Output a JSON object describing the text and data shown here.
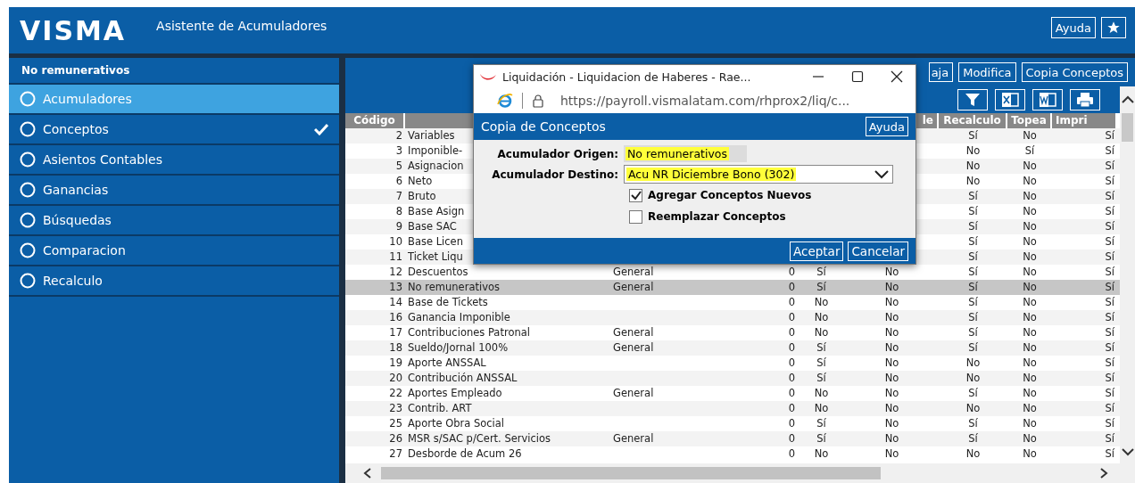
{
  "header": {
    "logo": "VISMA",
    "title": "Asistente de Acumuladores",
    "help_button": "Ayuda"
  },
  "sidebar": {
    "title": "No remunerativos",
    "items": [
      {
        "label": "Acumuladores",
        "selected": true,
        "done": false
      },
      {
        "label": "Conceptos",
        "selected": false,
        "done": true
      },
      {
        "label": "Asientos Contables",
        "selected": false,
        "done": false
      },
      {
        "label": "Ganancias",
        "selected": false,
        "done": false
      },
      {
        "label": "Búsquedas",
        "selected": false,
        "done": false
      },
      {
        "label": "Comparacion",
        "selected": false,
        "done": false
      },
      {
        "label": "Recalculo",
        "selected": false,
        "done": false
      }
    ]
  },
  "toolbar": {
    "buttons": [
      "aja",
      "Modifica",
      "Copia Conceptos"
    ]
  },
  "table": {
    "columns": [
      "Código",
      null,
      null,
      null,
      null,
      "le",
      "Recalculo",
      "Topea",
      "Impri"
    ],
    "rows": [
      {
        "cells": [
          "2",
          "Variables",
          null,
          null,
          null,
          null,
          "Sí",
          "No",
          "Sí"
        ],
        "selected": false
      },
      {
        "cells": [
          "3",
          "Imponible-",
          null,
          null,
          null,
          null,
          "No",
          "Sí",
          "Sí"
        ],
        "selected": false
      },
      {
        "cells": [
          "5",
          "Asignacion",
          null,
          null,
          null,
          null,
          "No",
          "No",
          "Sí"
        ],
        "selected": false
      },
      {
        "cells": [
          "6",
          "Neto",
          null,
          null,
          null,
          null,
          "No",
          "No",
          "Sí"
        ],
        "selected": false
      },
      {
        "cells": [
          "7",
          "Bruto",
          null,
          null,
          null,
          null,
          "Sí",
          "No",
          "Sí"
        ],
        "selected": false
      },
      {
        "cells": [
          "8",
          "Base Asign",
          null,
          null,
          null,
          null,
          "Sí",
          "No",
          "Sí"
        ],
        "selected": false
      },
      {
        "cells": [
          "9",
          "Base SAC",
          null,
          null,
          null,
          null,
          "Sí",
          "No",
          "Sí"
        ],
        "selected": false
      },
      {
        "cells": [
          "10",
          "Base Licen",
          null,
          null,
          null,
          null,
          "Sí",
          "No",
          "Sí"
        ],
        "selected": false
      },
      {
        "cells": [
          "11",
          "Ticket Liqu",
          null,
          null,
          null,
          null,
          "Sí",
          "No",
          "Sí"
        ],
        "selected": false
      },
      {
        "cells": [
          "12",
          "Descuentos",
          "General",
          "0",
          "Sí",
          "No",
          "Sí",
          "No",
          "Sí"
        ],
        "selected": false
      },
      {
        "cells": [
          "13",
          "No remunerativos",
          "General",
          "0",
          "Sí",
          "No",
          "Sí",
          "No",
          "Sí"
        ],
        "selected": true
      },
      {
        "cells": [
          "14",
          "Base de Tickets",
          null,
          "0",
          "No",
          "No",
          "Sí",
          "No",
          "Sí"
        ],
        "selected": false
      },
      {
        "cells": [
          "16",
          "Ganancia Imponible",
          null,
          "0",
          "No",
          "No",
          "Sí",
          "No",
          "Sí"
        ],
        "selected": false
      },
      {
        "cells": [
          "17",
          "Contribuciones Patronal",
          "General",
          "0",
          "No",
          "No",
          "Sí",
          "No",
          "Sí"
        ],
        "selected": false
      },
      {
        "cells": [
          "18",
          "Sueldo/Jornal 100%",
          "General",
          "0",
          "Sí",
          "No",
          "Sí",
          "No",
          "Sí"
        ],
        "selected": false
      },
      {
        "cells": [
          "19",
          "Aporte ANSSAL",
          null,
          "0",
          "Sí",
          "No",
          "No",
          "No",
          "Sí"
        ],
        "selected": false
      },
      {
        "cells": [
          "20",
          "Contribución ANSSAL",
          null,
          "0",
          "Sí",
          "No",
          "No",
          "No",
          "Sí"
        ],
        "selected": false
      },
      {
        "cells": [
          "22",
          "Aportes Empleado",
          "General",
          "0",
          "No",
          "No",
          "Sí",
          "No",
          "Sí"
        ],
        "selected": false
      },
      {
        "cells": [
          "23",
          "Contrib. ART",
          null,
          "0",
          "No",
          "No",
          "No",
          "No",
          "Sí"
        ],
        "selected": false
      },
      {
        "cells": [
          "25",
          "Aporte Obra Social",
          null,
          "0",
          "Sí",
          "No",
          "Sí",
          "No",
          "Sí"
        ],
        "selected": false
      },
      {
        "cells": [
          "26",
          "MSR s/SAC p/Cert. Servicios",
          "General",
          "0",
          "Sí",
          "No",
          "Sí",
          "No",
          "Sí"
        ],
        "selected": false
      },
      {
        "cells": [
          "27",
          "Desborde de Acum 26",
          null,
          "0",
          "No",
          "No",
          "No",
          "No",
          "Sí"
        ],
        "selected": false
      }
    ]
  },
  "popup": {
    "title": "Liquidación - Liquidacion de Haberes - Rae...",
    "url": "https://payroll.vismalatam.com/rhprox2/liq/c...",
    "dialog": {
      "title": "Copia de Conceptos",
      "help_button": "Ayuda",
      "fields": [
        {
          "kind": "readonly",
          "label": "Acumulador Origen:",
          "value": "No remunerativos",
          "highlighted": true
        },
        {
          "kind": "select",
          "label": "Acumulador Destino:",
          "value": "Acu NR Diciembre Bono (302)",
          "highlighted": true
        }
      ],
      "checkboxes": [
        {
          "label": "Agregar Conceptos Nuevos",
          "checked": true
        },
        {
          "label": "Reemplazar Conceptos",
          "checked": false
        }
      ],
      "buttons": [
        "Aceptar",
        "Cancelar"
      ]
    }
  }
}
